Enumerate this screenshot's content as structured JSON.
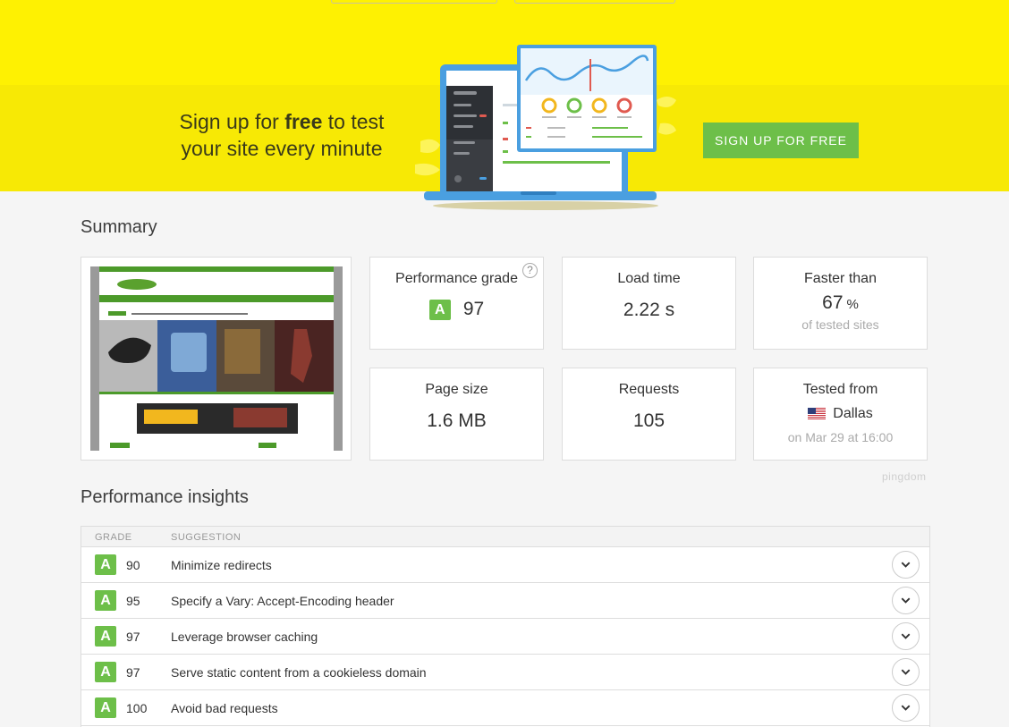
{
  "banner": {
    "text_before": "Sign up for ",
    "text_bold": "free",
    "text_after": " to test",
    "text_line2": "your site every minute",
    "signup_button": "SIGN UP FOR FREE",
    "colors": {
      "top": "#fef102",
      "bottom": "#f7e905",
      "button": "#6dbf49"
    }
  },
  "summary": {
    "title": "Summary",
    "performance_grade": {
      "label": "Performance grade",
      "grade": "A",
      "value": "97",
      "help": "?"
    },
    "load_time": {
      "label": "Load time",
      "value": "2.22 s"
    },
    "faster_than": {
      "label": "Faster than",
      "value": "67",
      "unit": "%",
      "sub": "of tested sites"
    },
    "page_size": {
      "label": "Page size",
      "value": "1.6 MB"
    },
    "requests": {
      "label": "Requests",
      "value": "105"
    },
    "tested_from": {
      "label": "Tested from",
      "location": "Dallas",
      "date": "on Mar 29 at 16:00",
      "flag_icon": "us-flag-icon"
    },
    "brand": "pingdom"
  },
  "insights": {
    "title": "Performance insights",
    "headers": {
      "grade": "GRADE",
      "suggestion": "SUGGESTION"
    },
    "rows": [
      {
        "grade": "A",
        "score": "90",
        "suggestion": "Minimize redirects"
      },
      {
        "grade": "A",
        "score": "95",
        "suggestion": "Specify a Vary: Accept-Encoding header"
      },
      {
        "grade": "A",
        "score": "97",
        "suggestion": "Leverage browser caching"
      },
      {
        "grade": "A",
        "score": "97",
        "suggestion": "Serve static content from a cookieless domain"
      },
      {
        "grade": "A",
        "score": "100",
        "suggestion": "Avoid bad requests"
      }
    ],
    "expand_icon": "chevron-down-icon",
    "grade_color": "#6dbf49"
  }
}
